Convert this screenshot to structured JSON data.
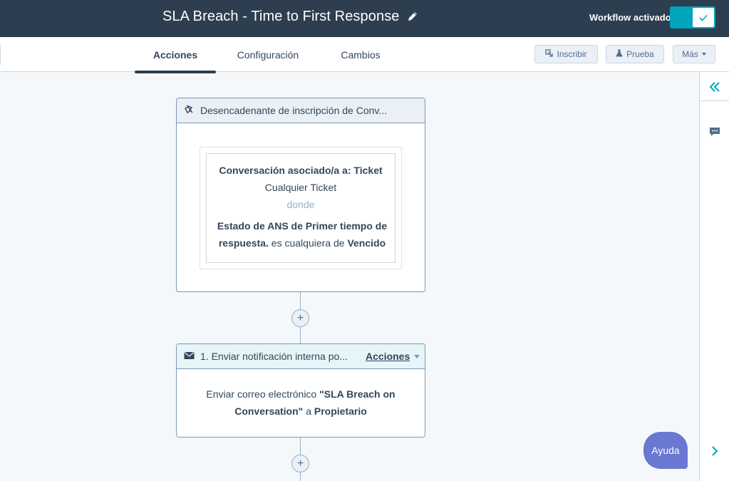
{
  "header": {
    "title": "SLA Breach - Time to First Response",
    "edit_icon": "pencil-icon",
    "status_label": "Workflow activado",
    "toggle_on": true,
    "accent": "#00a4bd",
    "bg": "#2d3e50"
  },
  "tabs": [
    {
      "label": "Acciones",
      "active": true
    },
    {
      "label": "Configuración",
      "active": false
    },
    {
      "label": "Cambios",
      "active": false
    }
  ],
  "toolbar": {
    "enroll_label": "Inscribir",
    "enroll_icon": "enroll-icon",
    "test_label": "Prueba",
    "test_icon": "flask-icon",
    "more_label": "Más"
  },
  "trigger": {
    "title": "Desencadenante de inscripción de Conv...",
    "icon": "trigger-icon",
    "filter": {
      "line1": "Conversación asociado/a a: Ticket",
      "line2": "Cualquier Ticket",
      "line3": "donde",
      "property": "Estado de ANS de Primer tiempo de respuesta.",
      "operator": " es cualquiera de ",
      "value": "Vencido"
    }
  },
  "action": {
    "title": "1. Enviar notificación interna po...",
    "icon": "envelope-icon",
    "menu_label": "Acciones",
    "body_prefix": "Enviar correo electrónico ",
    "email_name": "\"SLA Breach on Conversation\"",
    "body_mid": " a ",
    "recipient": "Propietario"
  },
  "side_panel": {
    "collapse_icon": "double-chevron-left-icon",
    "comment_icon": "comment-icon",
    "expand_icon": "chevron-right-icon"
  },
  "help": {
    "label": "Ayuda"
  }
}
